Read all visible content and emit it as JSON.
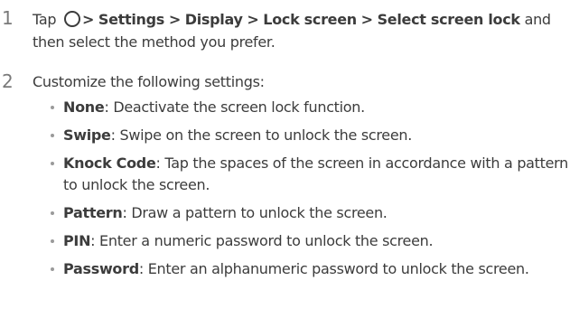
{
  "steps": [
    {
      "number": "1",
      "prefix": "Tap",
      "path": [
        {
          "sep": ">",
          "label": "Settings"
        },
        {
          "sep": ">",
          "label": "Display"
        },
        {
          "sep": ">",
          "label": "Lock screen"
        },
        {
          "sep": ">",
          "label": "Select screen lock"
        }
      ],
      "suffix": "and then select the method you prefer."
    },
    {
      "number": "2",
      "text": "Customize the following settings:"
    }
  ],
  "options": [
    {
      "term": "None",
      "desc": ": Deactivate the screen lock function."
    },
    {
      "term": "Swipe",
      "desc": ": Swipe on the screen to unlock the screen."
    },
    {
      "term": "Knock Code",
      "desc": ": Tap the spaces of the screen in accordance with a pattern to unlock the screen."
    },
    {
      "term": "Pattern",
      "desc": ": Draw a pattern to unlock the screen."
    },
    {
      "term": "PIN",
      "desc": ": Enter a numeric password to unlock the screen."
    },
    {
      "term": "Password",
      "desc": ": Enter an alphanumeric password to unlock the screen."
    }
  ],
  "icons": {
    "home": "home-button-icon"
  }
}
